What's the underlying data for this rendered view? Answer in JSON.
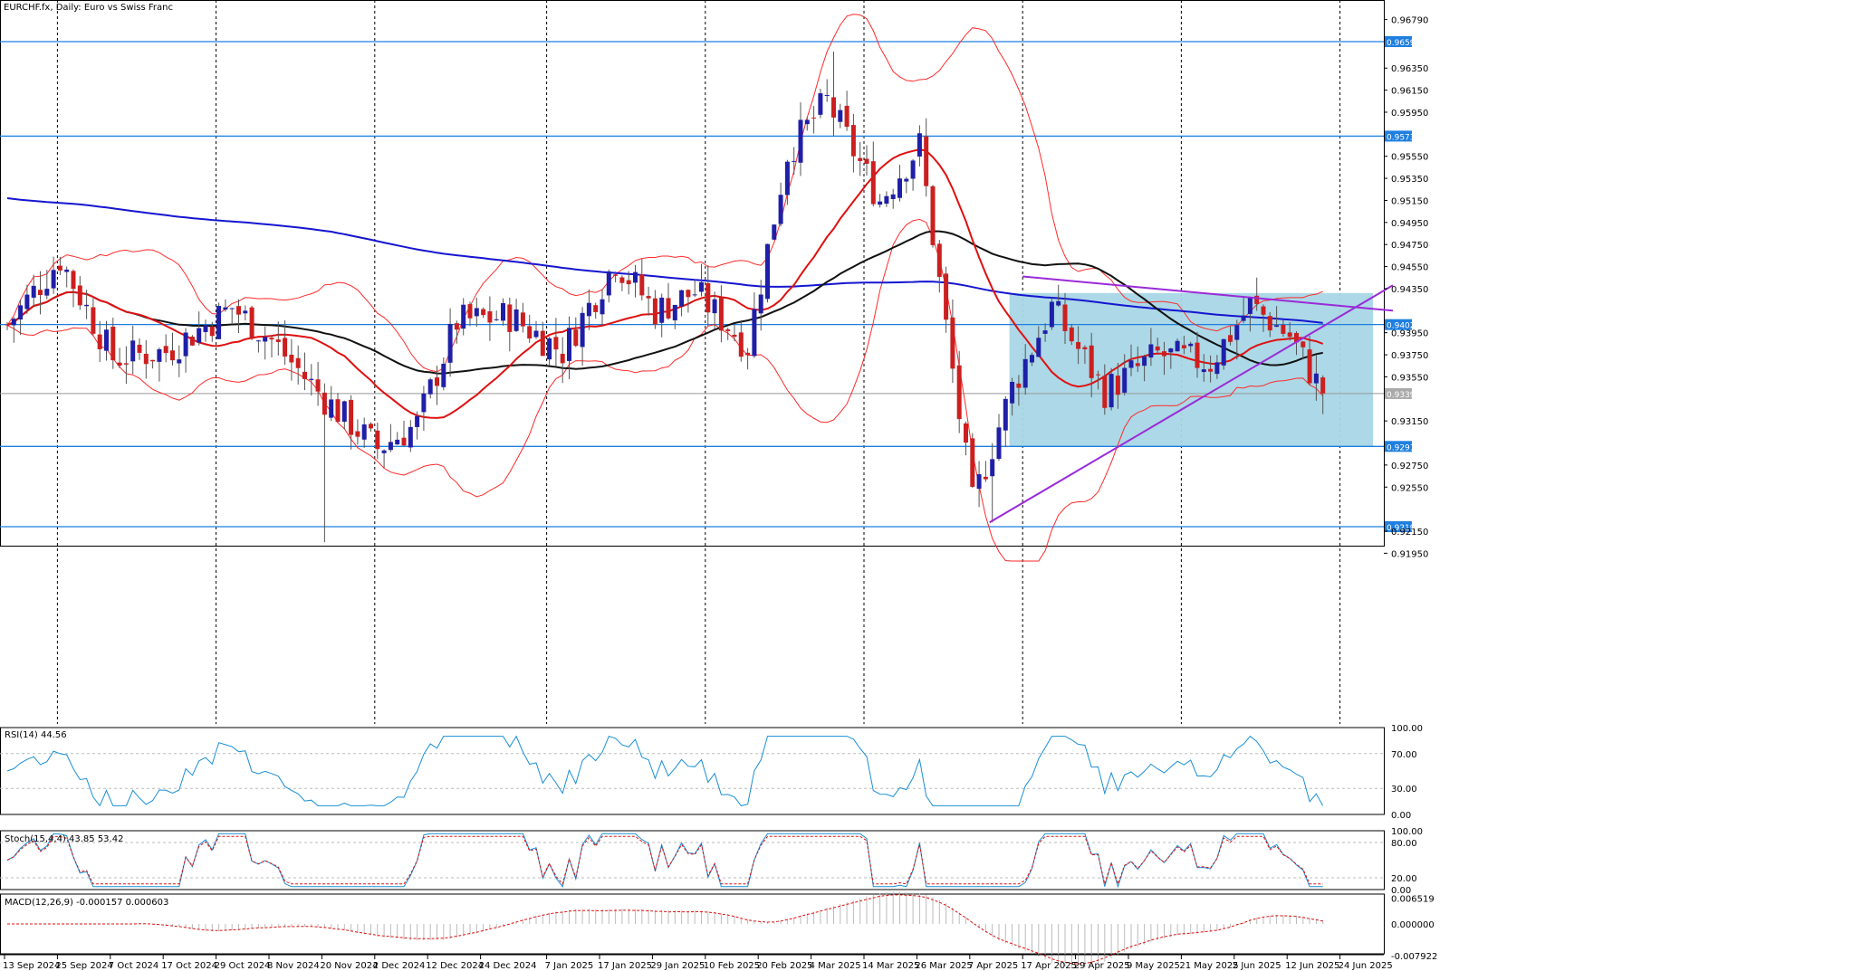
{
  "chart": {
    "title": "EURCHF.fx, Daily:  Euro vs Swiss Franc",
    "colors": {
      "bull": "#1f1fa8",
      "bear": "#cc1f1f",
      "bb": "#ff2a2a",
      "ma_fast": "#e01010",
      "ma_mid": "#111111",
      "ma_slow": "#1515d0",
      "hline": "#1e7fe0",
      "trend": "#9a2ad8",
      "box": "#a8d6e6",
      "osc": "#1a8fd6",
      "signal": "#e01010"
    }
  },
  "chart_data": {
    "type": "candlestick",
    "ylim": [
      0.9175,
      0.9685
    ],
    "y_ticks": [
      "0.96790",
      "0.96350",
      "0.96150",
      "0.95950",
      "0.95550",
      "0.95350",
      "0.95150",
      "0.94950",
      "0.94750",
      "0.94550",
      "0.94350",
      "0.93950",
      "0.93750",
      "0.93550",
      "0.93150",
      "0.92750",
      "0.92550",
      "0.92150",
      "0.91950"
    ],
    "x_labels": [
      "13 Sep 2024",
      "25 Sep 2024",
      "7 Oct 2024",
      "17 Oct 2024",
      "29 Oct 2024",
      "8 Nov 2024",
      "20 Nov 2024",
      "2 Dec 2024",
      "12 Dec 2024",
      "24 Dec 2024",
      "7 Jan 2025",
      "17 Jan 2025",
      "29 Jan 2025",
      "10 Feb 2025",
      "20 Feb 2025",
      "4 Mar 2025",
      "14 Mar 2025",
      "26 Mar 2025",
      "7 Apr 2025",
      "17 Apr 2025",
      "29 Apr 2025",
      "9 May 2025",
      "21 May 2025",
      "2 Jun 2025",
      "12 Jun 2025",
      "24 Jun 2025"
    ],
    "dashed_dates": [
      "25 Sep 2024",
      "29 Oct 2024",
      "2 Dec 2024",
      "7 Jan 2025",
      "10 Feb 2025",
      "14 Mar 2025",
      "17 Apr 2025",
      "21 May 2025",
      "24 Jun 2025"
    ],
    "price_levels": [
      "0.96590",
      "0.95733",
      "0.94024",
      "0.92919",
      "0.92191"
    ],
    "current_price": "0.93398",
    "key_prices": [
      {
        "date": "20 Nov 2024",
        "low": 0.9205
      },
      {
        "date": "7 Mar 2025",
        "high": 0.965
      },
      {
        "date": "10 Apr 2025",
        "low": 0.9223
      },
      {
        "date": "27 Jun 2025",
        "close": 0.934
      }
    ],
    "box": {
      "from": "15 Apr 2025",
      "to": "1 Jul 2025",
      "top": 0.9431,
      "bottom": 0.9292
    },
    "trendlines": [
      {
        "from": [
          "10 Apr 2025",
          0.9223
        ],
        "to": [
          "4 Jul 2025",
          0.9438
        ]
      },
      {
        "from": [
          "17 Apr 2025",
          0.9446
        ],
        "to": [
          "4 Jul 2025",
          0.9415
        ]
      }
    ],
    "indicators": {
      "rsi": {
        "label": "RSI(14) 44.56",
        "levels": [
          "70.00",
          "30.00"
        ],
        "top": "100.00",
        "bottom": "0.00",
        "value": 44.56
      },
      "stoch": {
        "label": "Stoch(15,4,4) 43.85 53.42",
        "levels": [
          "80.00",
          "20.00"
        ],
        "top": "100.00",
        "bottom": "0.00",
        "main": 43.85,
        "signal": 53.42
      },
      "macd": {
        "label": "MACD(12,26,9) -0.000157 0.000603",
        "levels": [
          "0.006519",
          "0.000000",
          "-0.007922"
        ],
        "main": -0.000157,
        "signal": 0.000603
      }
    }
  }
}
